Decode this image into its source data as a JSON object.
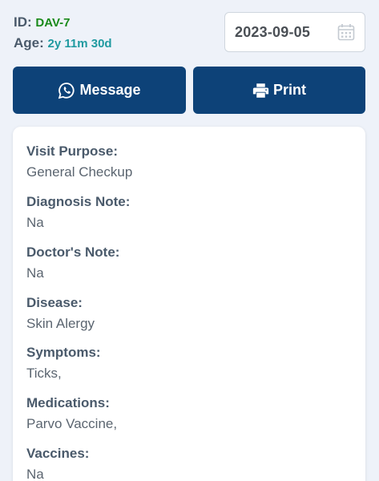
{
  "patient": {
    "id_label": "ID:",
    "id_value": "DAV-7",
    "age_label": "Age:",
    "age_value": "2y 11m 30d"
  },
  "date": {
    "value": "2023-09-05",
    "icon": "calendar-icon"
  },
  "actions": {
    "message_label": "Message",
    "message_icon": "whatsapp-icon",
    "print_label": "Print",
    "print_icon": "printer-icon"
  },
  "colors": {
    "primary_button": "#0d4278",
    "id_value": "#1a8a1a",
    "age_value": "#1f9aa0",
    "background": "#eef2f9"
  },
  "record": {
    "fields": [
      {
        "label": "Visit Purpose:",
        "value": "General Checkup"
      },
      {
        "label": "Diagnosis Note:",
        "value": "Na"
      },
      {
        "label": "Doctor's Note:",
        "value": "Na"
      },
      {
        "label": "Disease:",
        "value": "Skin Alergy"
      },
      {
        "label": "Symptoms:",
        "value": "Ticks,"
      },
      {
        "label": "Medications:",
        "value": "Parvo Vaccine,"
      },
      {
        "label": "Vaccines:",
        "value": "Na"
      }
    ]
  }
}
